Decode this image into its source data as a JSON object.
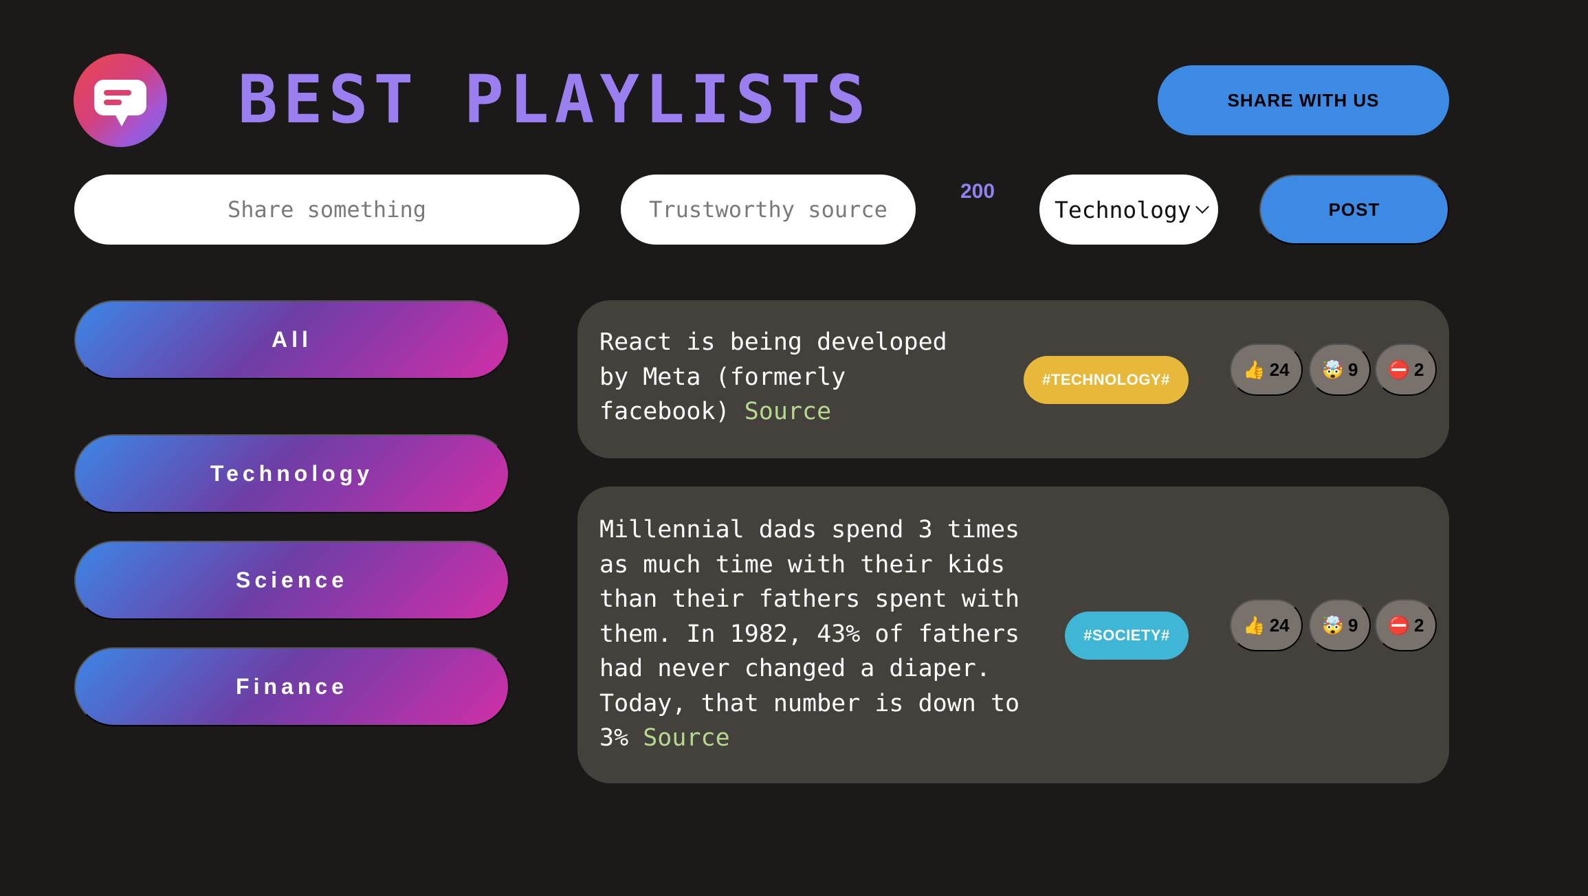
{
  "header": {
    "title": "BEST PLAYLISTS",
    "share_label": "SHARE WITH US",
    "logo_icon": "chat-bubble-icon"
  },
  "form": {
    "text_placeholder": "Share something",
    "source_placeholder": "Trustworthy source",
    "char_count": "200",
    "category_selected": "Technology",
    "post_label": "POST"
  },
  "categories": [
    {
      "label": "All"
    },
    {
      "label": "Technology"
    },
    {
      "label": "Science"
    },
    {
      "label": "Finance"
    }
  ],
  "posts": [
    {
      "text": "React is being developed by Meta (formerly facebook)",
      "source_label": "Source",
      "tag": "#TECHNOLOGY#",
      "tag_color": "#e8b83b",
      "votes": {
        "like": "24",
        "mindblown": "9",
        "false": "2"
      }
    },
    {
      "text": "Millennial dads spend 3 times as much time with their kids than their fathers spent with them. In 1982, 43% of fathers had never changed a diaper. Today, that number is down to 3%",
      "source_label": "Source",
      "tag": "#SOCIETY#",
      "tag_color": "#3fb6d6",
      "votes": {
        "like": "24",
        "mindblown": "9",
        "false": "2"
      }
    }
  ],
  "icons": {
    "like": "👍",
    "mindblown": "🤯",
    "false": "⛔️"
  },
  "colors": {
    "accent": "#3c8ae3",
    "title": "#9b7ff0",
    "card": "#44403c",
    "source": "#b6d98f"
  }
}
